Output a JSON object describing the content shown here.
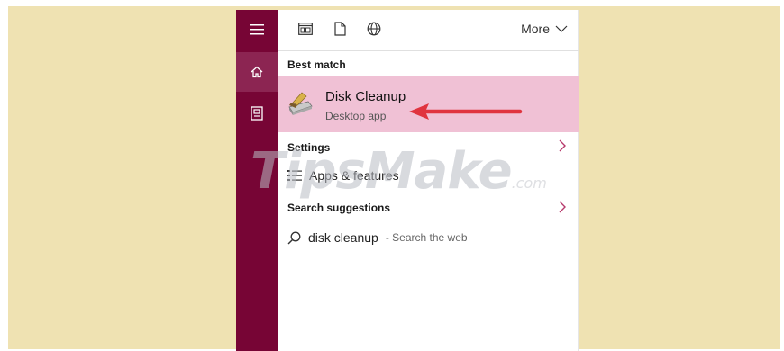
{
  "colors": {
    "backdrop": "#efe2b2",
    "rail": "#770535",
    "highlight": "#f0c1d5",
    "accent": "#b73a6c",
    "arrow": "#e0343f"
  },
  "rail": {
    "items": [
      {
        "icon": "hamburger-icon"
      },
      {
        "icon": "home-icon"
      },
      {
        "icon": "documents-icon"
      }
    ]
  },
  "filter_bar": {
    "icons": [
      "apps-filter-icon",
      "documents-filter-icon",
      "web-filter-icon"
    ],
    "more_label": "More"
  },
  "best_match": {
    "header": "Best match",
    "title": "Disk Cleanup",
    "subtitle": "Desktop app",
    "icon": "disk-cleanup-icon"
  },
  "settings": {
    "header": "Settings",
    "item_label": "Apps & features",
    "item_icon": "apps-features-icon"
  },
  "suggestions": {
    "header": "Search suggestions",
    "query": "disk cleanup",
    "hint": "- Search the web",
    "icon": "search-icon"
  },
  "watermark": {
    "main": "TipsMake",
    "suffix": ".com"
  }
}
